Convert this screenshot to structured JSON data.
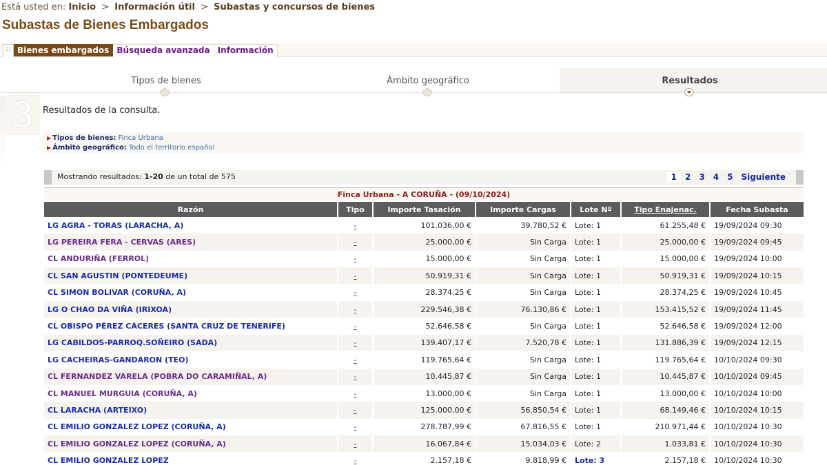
{
  "breadcrumb": {
    "prefix": "Está usted en:",
    "items": [
      "Inicio",
      "Información útil",
      "Subastas y concursos de bienes"
    ]
  },
  "page_title": "Subastas de Bienes Embargados",
  "tabs": [
    {
      "label": "Bienes embargados",
      "active": true
    },
    {
      "label": "Búsqueda avanzada",
      "active": false
    },
    {
      "label": "Información",
      "active": false
    }
  ],
  "steps": [
    {
      "label": "Tipos de bienes",
      "active": false
    },
    {
      "label": "Ámbito geográfico",
      "active": false
    },
    {
      "label": "Resultados",
      "active": true
    }
  ],
  "step_number": "3",
  "results_heading": "Resultados de la consulta.",
  "filters": [
    {
      "label": "Tipos de bienes:",
      "value": "Finca Urbana"
    },
    {
      "label": "Ámbito geográfico:",
      "value": "Todo el territorio español"
    }
  ],
  "pager": {
    "showing_prefix": "Mostrando resultados:",
    "range": "1-20",
    "total_text": "de un total de 575",
    "pages": [
      "1",
      "2",
      "3",
      "4",
      "5"
    ],
    "next": "Siguiente"
  },
  "group_title": "Finca Urbana - A CORUÑA - (09/10/2024)",
  "columns": [
    "Razón",
    "Tipo",
    "Importe Tasación",
    "Importe Cargas",
    "Lote Nº",
    "Tipo Enajenac.",
    "Fecha Subasta"
  ],
  "rows": [
    {
      "razon": "LG AGRA - TORAS (LARACHA, A)",
      "tipo": "-",
      "tasacion": "101.036,00 €",
      "cargas": "39.780,52 €",
      "lote": "Lote: 1",
      "enajenac": "61.255,48 €",
      "fecha": "19/09/2024 09:30",
      "visited": false
    },
    {
      "razon": "LG PEREIRA FERA - CERVAS (ARES)",
      "tipo": "-",
      "tasacion": "25.000,00 €",
      "cargas": "Sin Carga",
      "lote": "Lote: 1",
      "enajenac": "25.000,00 €",
      "fecha": "19/09/2024 09:45",
      "visited": true
    },
    {
      "razon": "CL ANDURIÑA (FERROL)",
      "tipo": "-",
      "tasacion": "15.000,00 €",
      "cargas": "Sin Carga",
      "lote": "Lote: 1",
      "enajenac": "15.000,00 €",
      "fecha": "19/09/2024 10:00",
      "visited": true
    },
    {
      "razon": "CL SAN AGUSTIN (PONTEDEUME)",
      "tipo": "-",
      "tasacion": "50.919,31 €",
      "cargas": "Sin Carga",
      "lote": "Lote: 1",
      "enajenac": "50.919,31 €",
      "fecha": "19/09/2024 10:15",
      "visited": false
    },
    {
      "razon": "CL SIMON BOLIVAR (CORUÑA, A)",
      "tipo": "-",
      "tasacion": "28.374,25 €",
      "cargas": "Sin Carga",
      "lote": "Lote: 1",
      "enajenac": "28.374,25 €",
      "fecha": "19/09/2024 10:45",
      "visited": false
    },
    {
      "razon": "LG O CHAO DA VIÑA (IRIXOA)",
      "tipo": "-",
      "tasacion": "229.546,38 €",
      "cargas": "76.130,86 €",
      "lote": "Lote: 1",
      "enajenac": "153.415,52 €",
      "fecha": "19/09/2024 11:45",
      "visited": false
    },
    {
      "razon": "CL OBISPO PÉREZ CÁCERES (SANTA CRUZ DE TENERIFE)",
      "tipo": "-",
      "tasacion": "52.646,58 €",
      "cargas": "Sin Carga",
      "lote": "Lote: 1",
      "enajenac": "52.646,58 €",
      "fecha": "19/09/2024 12:00",
      "visited": false
    },
    {
      "razon": "LG CABILDOS-PARROQ.SOÑEIRO (SADA)",
      "tipo": "-",
      "tasacion": "139.407,17 €",
      "cargas": "7.520,78 €",
      "lote": "Lote: 1",
      "enajenac": "131.886,39 €",
      "fecha": "19/09/2024 12:15",
      "visited": false
    },
    {
      "razon": "LG CACHEIRAS-GANDARON (TEO)",
      "tipo": "-",
      "tasacion": "119.765,64 €",
      "cargas": "Sin Carga",
      "lote": "Lote: 1",
      "enajenac": "119.765,64 €",
      "fecha": "10/10/2024 09:30",
      "visited": false
    },
    {
      "razon": "CL FERNANDEZ VARELA (POBRA DO CARAMIÑAL, A)",
      "tipo": "-",
      "tasacion": "10.445,87 €",
      "cargas": "Sin Carga",
      "lote": "Lote: 1",
      "enajenac": "10.445,87 €",
      "fecha": "10/10/2024 09:45",
      "visited": true
    },
    {
      "razon": "CL MANUEL MURGUIA (CORUÑA, A)",
      "tipo": "-",
      "tasacion": "13.000,00 €",
      "cargas": "Sin Carga",
      "lote": "Lote: 1",
      "enajenac": "13.000,00 €",
      "fecha": "10/10/2024 10:00",
      "visited": true
    },
    {
      "razon": "CL LARACHA (ARTEIXO)",
      "tipo": "-",
      "tasacion": "125.000,00 €",
      "cargas": "56.850,54 €",
      "lote": "Lote: 1",
      "enajenac": "68.149,46 €",
      "fecha": "10/10/2024 10:15",
      "visited": false
    },
    {
      "razon": "CL EMILIO GONZALEZ LOPEZ (CORUÑA, A)",
      "tipo": "-",
      "tasacion": "278.787,99 €",
      "cargas": "67.816,55 €",
      "lote": "Lote: 1",
      "enajenac": "210.971,44 €",
      "fecha": "10/10/2024 10:30",
      "visited": false
    },
    {
      "razon": "CL EMILIO GONZALEZ LOPEZ (CORUÑA, A)",
      "tipo": "-",
      "tasacion": "16.067,84 €",
      "cargas": "15.034,03 €",
      "lote": "Lote: 2",
      "enajenac": "1.033,81 €",
      "fecha": "10/10/2024 10:30",
      "visited": true
    },
    {
      "razon": "CL EMILIO GONZALEZ LOPEZ",
      "tipo": "-",
      "tasacion": "2.157,18 €",
      "cargas": "9.818,99 €",
      "lote": "Lote: 3",
      "enajenac": "2.157,18 €",
      "fecha": "10/10/2024 10:30",
      "visited": false,
      "lote_link": true
    }
  ]
}
